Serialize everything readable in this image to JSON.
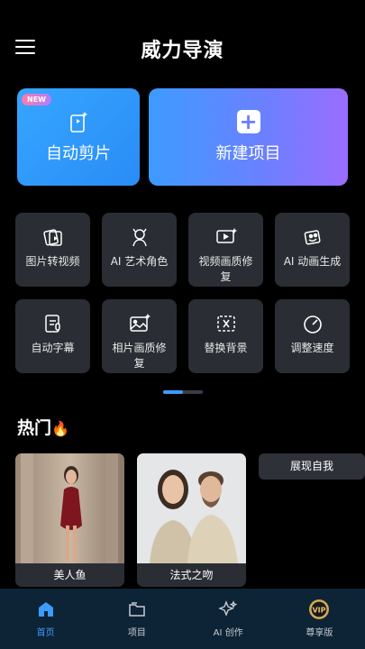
{
  "header": {
    "title": "威力导演"
  },
  "cards": {
    "auto_edit": {
      "label": "自动剪片",
      "badge": "NEW",
      "icon": "auto-edit-icon"
    },
    "new_project": {
      "label": "新建项目",
      "icon": "plus-icon"
    }
  },
  "tools": [
    {
      "label": "图片转视频",
      "icon": "photo-to-video-icon"
    },
    {
      "label": "AI 艺术角色",
      "icon": "ai-character-icon"
    },
    {
      "label": "视频画质修复",
      "icon": "video-enhance-icon"
    },
    {
      "label": "AI 动画生成",
      "icon": "ai-animation-icon"
    },
    {
      "label": "自动字幕",
      "icon": "caption-icon"
    },
    {
      "label": "相片画质修复",
      "icon": "photo-enhance-icon"
    },
    {
      "label": "替换背景",
      "icon": "background-replace-icon"
    },
    {
      "label": "调整速度",
      "icon": "speed-icon"
    }
  ],
  "hot": {
    "title": "热门",
    "items": [
      {
        "label": "美人鱼"
      },
      {
        "label": "法式之吻"
      }
    ],
    "chip": "展现自我"
  },
  "nav": [
    {
      "label": "首页",
      "icon": "home-icon",
      "active": true
    },
    {
      "label": "项目",
      "icon": "folder-icon",
      "active": false
    },
    {
      "label": "AI 创作",
      "icon": "sparkle-icon",
      "active": false
    },
    {
      "label": "尊享版",
      "icon": "vip-icon",
      "active": false
    }
  ],
  "colors": {
    "accent": "#3d9bff",
    "background": "#000000",
    "tile": "#2a2d33",
    "nav_bg": "#0d2336"
  }
}
